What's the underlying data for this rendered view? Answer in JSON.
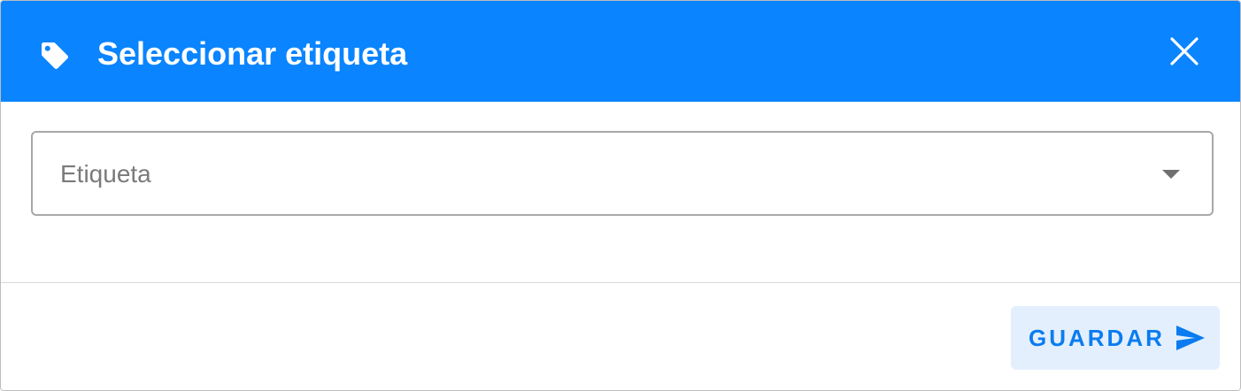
{
  "dialog": {
    "title": "Seleccionar etiqueta",
    "header_icon": "tag-icon",
    "close_icon": "close-icon",
    "header_color": "#0a84ff"
  },
  "form": {
    "select_placeholder": "Etiqueta",
    "select_caret_icon": "caret-down-icon"
  },
  "footer": {
    "save_label": "GUARDAR",
    "save_icon": "send-icon",
    "save_button_bg": "#e3effd",
    "save_text_color": "#0a7cf0"
  }
}
